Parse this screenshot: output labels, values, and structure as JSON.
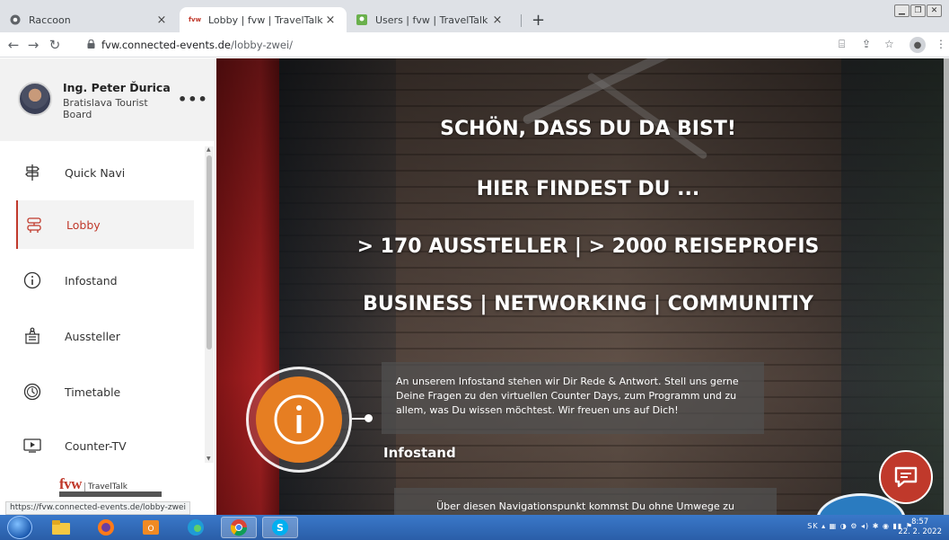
{
  "tabs": [
    {
      "title": "Raccoon",
      "icon": "chrome-favicon",
      "active": false
    },
    {
      "title": "Lobby | fvw | TravelTalk",
      "icon": "fvw-favicon",
      "active": true
    },
    {
      "title": "Users | fvw | TravelTalk",
      "icon": "users-favicon",
      "active": false
    }
  ],
  "tab_close": "×",
  "new_tab": "+",
  "toolbar": {
    "url_host": "fvw.connected-events.de",
    "url_path": "/lobby-zwei/"
  },
  "user": {
    "name": "Ing. Peter Ďurica",
    "org": "Bratislava Tourist Board",
    "more": "•••"
  },
  "nav": {
    "items": [
      {
        "label": "Quick Navi",
        "icon": "signpost-icon"
      },
      {
        "label": "Lobby",
        "icon": "lobby-icon",
        "active": true
      },
      {
        "label": "Infostand",
        "icon": "info-icon"
      },
      {
        "label": "Aussteller",
        "icon": "booth-icon"
      },
      {
        "label": "Timetable",
        "icon": "clock-icon"
      },
      {
        "label": "Counter-TV",
        "icon": "play-icon"
      }
    ]
  },
  "logo": {
    "brand": "fvw",
    "sub": "TravelTalk"
  },
  "hero": {
    "line1": "SCHÖN, DASS DU DA BIST!",
    "line2": "HIER FINDEST DU ...",
    "line3": "> 170 AUSSTELLER | > 2000 REISEPROFIS",
    "line4": "BUSINESS | NETWORKING | COMMUNITIY",
    "infostand_text": "An unserem Infostand stehen wir Dir Rede & Antwort. Stell uns gerne Deine Fragen zu den virtuellen Counter Days, zum Programm und zu allem, was Du wissen möchtest. Wir freuen uns auf Dich!",
    "infostand_title": "Infostand",
    "quicknav_text": "Über diesen Navigationspunkt kommst Du ohne Umwege zu"
  },
  "status_url": "https://fvw.connected-events.de/lobby-zwei",
  "taskbar": {
    "tray_lang": "SK",
    "time": "8:57",
    "date": "22. 2. 2022"
  },
  "colors": {
    "accent": "#c0392b",
    "info_orange": "#e67e22"
  }
}
